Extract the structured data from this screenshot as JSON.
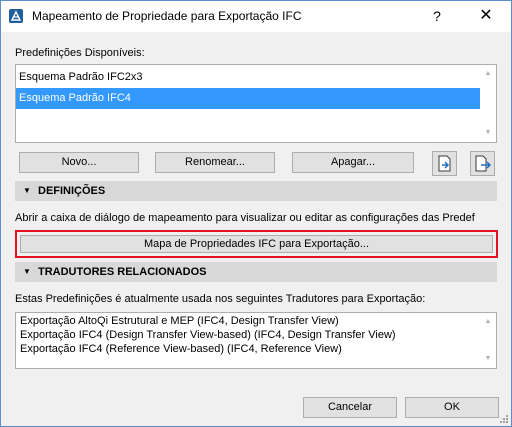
{
  "window": {
    "title": "Mapeamento de Propriedade para Exportação IFC",
    "help": "?",
    "close": "✕"
  },
  "presets": {
    "label": "Predefinições Disponíveis:",
    "items": [
      {
        "label": "Esquema Padrão IFC2x3",
        "selected": false
      },
      {
        "label": "Esquema Padrão IFC4",
        "selected": true
      }
    ]
  },
  "preset_buttons": {
    "new": "Novo...",
    "rename": "Renomear...",
    "delete": "Apagar..."
  },
  "settings": {
    "header": "DEFINIÇÕES",
    "description": "Abrir a caixa de diálogo de mapeamento para visualizar ou editar as configurações das Predef",
    "mapping_button": "Mapa de Propriedades IFC para Exportação..."
  },
  "translators": {
    "header": "TRADUTORES RELACIONADOS",
    "description": "Estas Predefinições é atualmente usada nos seguintes Tradutores para Exportação:",
    "lines": [
      "Exportação AltoQi Estrutural e MEP (IFC4, Design Transfer View)",
      "Exportação IFC4 (Design Transfer View-based) (IFC4, Design Transfer View)",
      "Exportação IFC4 (Reference View-based) (IFC4, Reference View)"
    ]
  },
  "footer": {
    "cancel": "Cancelar",
    "ok": "OK"
  },
  "colors": {
    "selection": "#3399ff",
    "highlight_border": "#e81123",
    "section_bg": "#d8d8d8"
  }
}
